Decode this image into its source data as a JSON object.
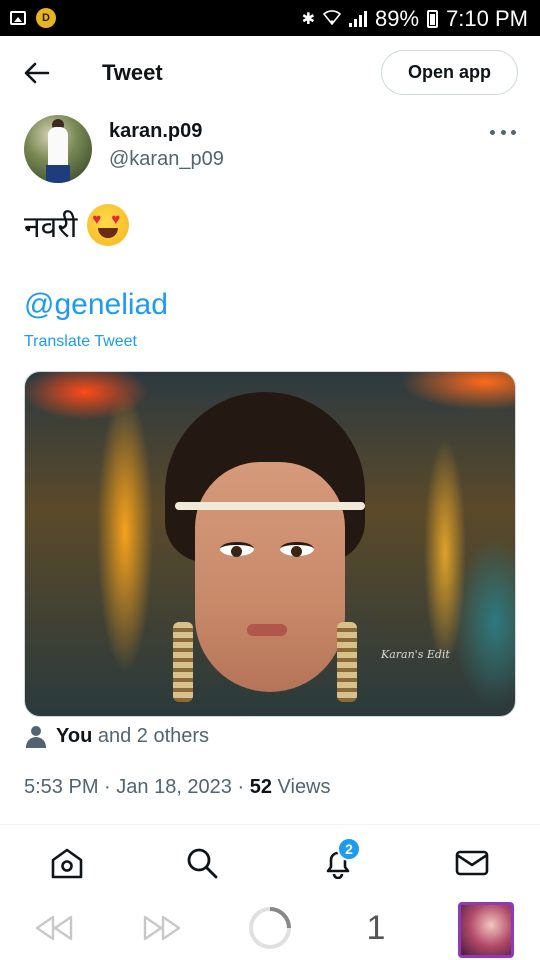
{
  "status_bar": {
    "battery": "89%",
    "time": "7:10 PM",
    "coin_label": "D"
  },
  "header": {
    "title": "Tweet",
    "open_app_label": "Open app"
  },
  "tweet": {
    "author_name": "karan.p09",
    "author_handle": "@karan_p09",
    "text": "नवरी",
    "emoji": "heart-eyes",
    "mention": "@geneliad",
    "translate_label": "Translate Tweet",
    "watermark": "Karan's Edit",
    "likes_you": "You",
    "likes_rest": "and 2 others",
    "time": "5:53 PM",
    "date": "Jan 18, 2023",
    "views_count": "52",
    "views_label": "Views"
  },
  "nav": {
    "items": [
      "home-icon",
      "search-icon",
      "notifications-icon",
      "messages-icon"
    ],
    "notifications_badge": "2"
  },
  "system_bar": {
    "page_number": "1"
  },
  "colors": {
    "accent": "#1d9bf0",
    "text": "#0f1419",
    "secondary": "#536471"
  }
}
